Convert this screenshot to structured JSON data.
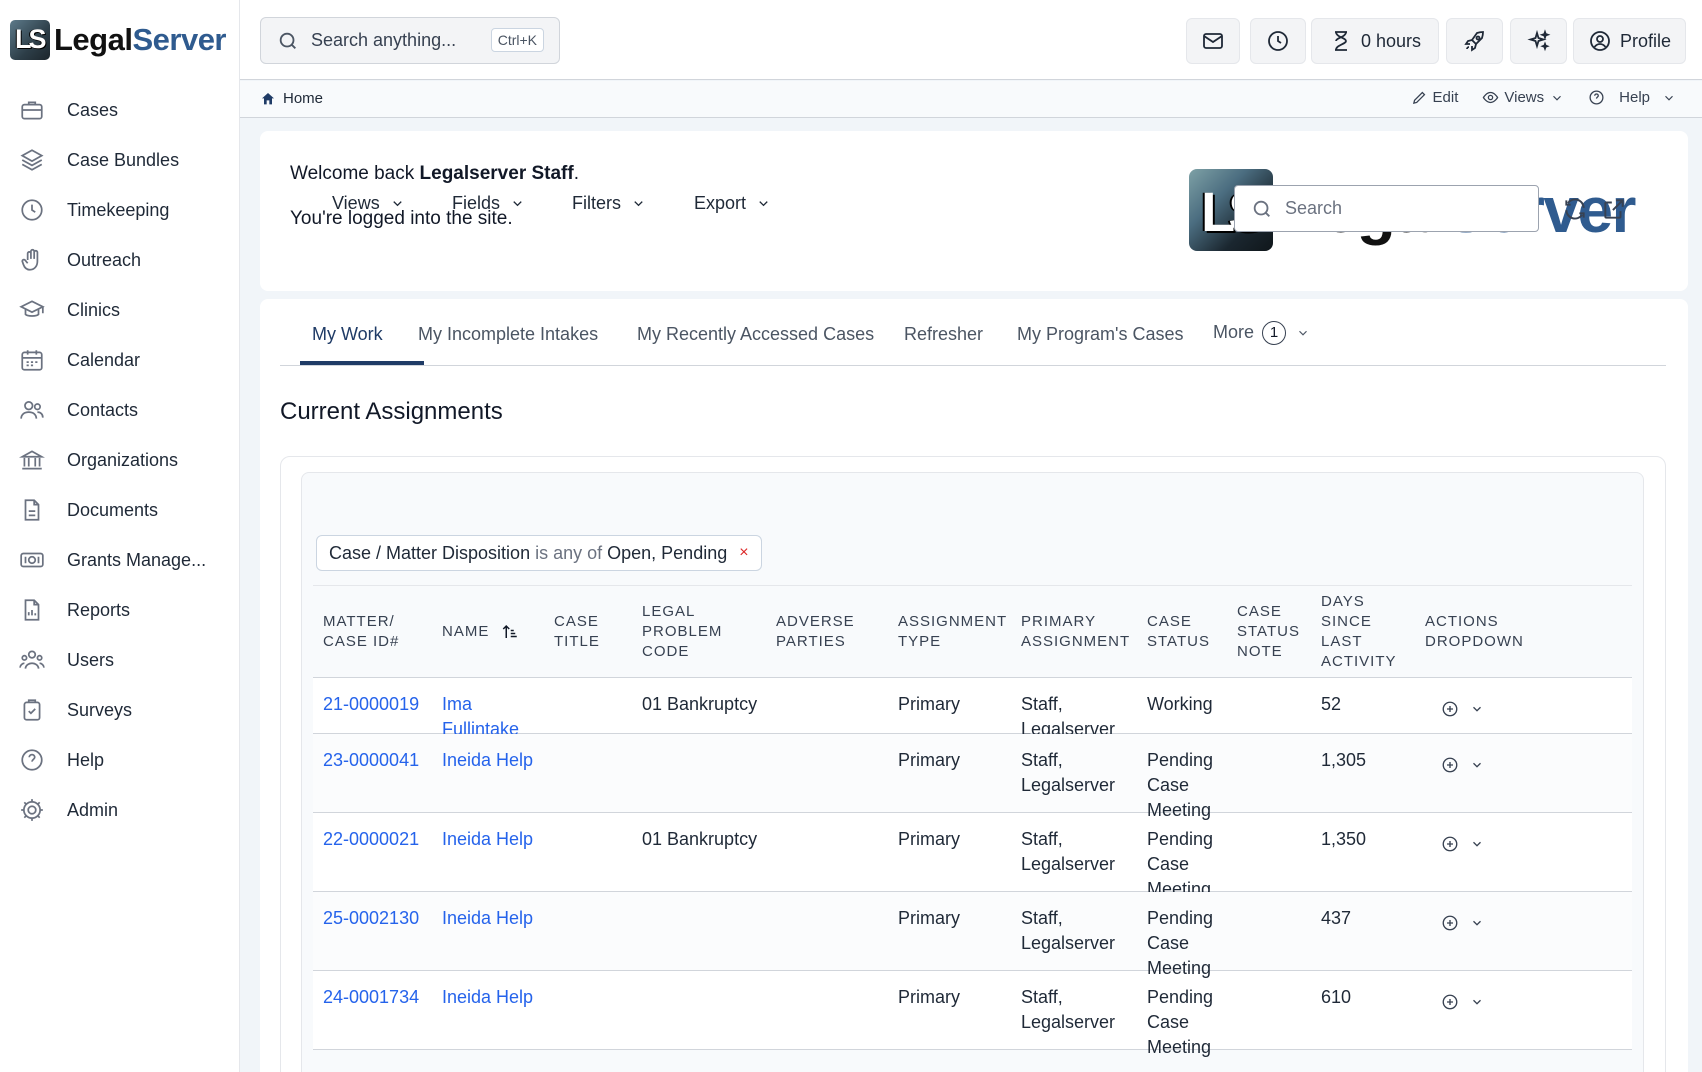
{
  "brand": {
    "name_part1": "Legal",
    "name_part2": "Server",
    "mark": "LS"
  },
  "sidebar": {
    "items": [
      {
        "label": "Cases",
        "icon": "briefcase-icon"
      },
      {
        "label": "Case Bundles",
        "icon": "layers-icon"
      },
      {
        "label": "Timekeeping",
        "icon": "clock-icon"
      },
      {
        "label": "Outreach",
        "icon": "hand-icon"
      },
      {
        "label": "Clinics",
        "icon": "graduation-cap-icon"
      },
      {
        "label": "Calendar",
        "icon": "calendar-icon"
      },
      {
        "label": "Contacts",
        "icon": "people-icon"
      },
      {
        "label": "Organizations",
        "icon": "bank-icon"
      },
      {
        "label": "Documents",
        "icon": "document-icon"
      },
      {
        "label": "Grants Manage...",
        "icon": "money-icon"
      },
      {
        "label": "Reports",
        "icon": "report-icon"
      },
      {
        "label": "Users",
        "icon": "users-icon"
      },
      {
        "label": "Surveys",
        "icon": "clipboard-check-icon"
      },
      {
        "label": "Help",
        "icon": "question-icon"
      },
      {
        "label": "Admin",
        "icon": "gear-icon"
      }
    ]
  },
  "topbar": {
    "search_placeholder": "Search anything...",
    "search_shortcut": "Ctrl+K",
    "hours_label": "0 hours",
    "profile_label": "Profile"
  },
  "breadcrumb": {
    "home": "Home"
  },
  "page_actions": {
    "edit": "Edit",
    "views": "Views",
    "help": "Help"
  },
  "welcome": {
    "prefix": "Welcome back ",
    "user": "Legalserver Staff",
    "suffix": ".",
    "status": "You're logged into the site."
  },
  "tabs": [
    {
      "label": "My Work",
      "active": true
    },
    {
      "label": "My Incomplete Intakes"
    },
    {
      "label": "My Recently Accessed Cases"
    },
    {
      "label": "Refresher"
    },
    {
      "label": "My Program's Cases"
    },
    {
      "label": "More",
      "badge": "1"
    }
  ],
  "section_title": "Current Assignments",
  "grid_toolbar": {
    "views": "Views",
    "fields": "Fields",
    "filters": "Filters",
    "export": "Export",
    "search_placeholder": "Search"
  },
  "filter_chip": {
    "field": "Case / Matter Disposition",
    "op": "is any of",
    "values": "Open, Pending",
    "remove": "×"
  },
  "table": {
    "columns": [
      "MATTER/\nCASE ID#",
      "NAME",
      "CASE\nTITLE",
      "LEGAL\nPROBLEM\nCODE",
      "ADVERSE\nPARTIES",
      "ASSIGNMENT\nTYPE",
      "PRIMARY\nASSIGNMENT",
      "CASE\nSTATUS",
      "CASE\nSTATUS\nNOTE",
      "DAYS\nSINCE\nLAST\nACTIVITY",
      "ACTIONS\nDROPDOWN"
    ],
    "rows": [
      {
        "id": "21-0000019",
        "name": "Ima\nFullintake",
        "title": "",
        "code": "01 Bankruptcy",
        "adverse": "",
        "type": "Primary",
        "primary": "Staff,\nLegalserver",
        "status": "Working",
        "note": "",
        "days": "52"
      },
      {
        "id": "23-0000041",
        "name": "Ineida Help",
        "title": "",
        "code": "",
        "adverse": "",
        "type": "Primary",
        "primary": "Staff,\nLegalserver",
        "status": "Pending\nCase\nMeeting",
        "note": "",
        "days": "1,305"
      },
      {
        "id": "22-0000021",
        "name": "Ineida Help",
        "title": "",
        "code": "01 Bankruptcy",
        "adverse": "",
        "type": "Primary",
        "primary": "Staff,\nLegalserver",
        "status": "Pending\nCase\nMeeting",
        "note": "",
        "days": "1,350"
      },
      {
        "id": "25-0002130",
        "name": "Ineida Help",
        "title": "",
        "code": "",
        "adverse": "",
        "type": "Primary",
        "primary": "Staff,\nLegalserver",
        "status": "Pending\nCase\nMeeting",
        "note": "",
        "days": "437"
      },
      {
        "id": "24-0001734",
        "name": "Ineida Help",
        "title": "",
        "code": "",
        "adverse": "",
        "type": "Primary",
        "primary": "Staff,\nLegalserver",
        "status": "Pending\nCase\nMeeting",
        "note": "",
        "days": "610"
      }
    ]
  },
  "colors": {
    "accent": "#1f3b66",
    "link": "#2563eb",
    "brand_blue": "#2f5b8f"
  }
}
